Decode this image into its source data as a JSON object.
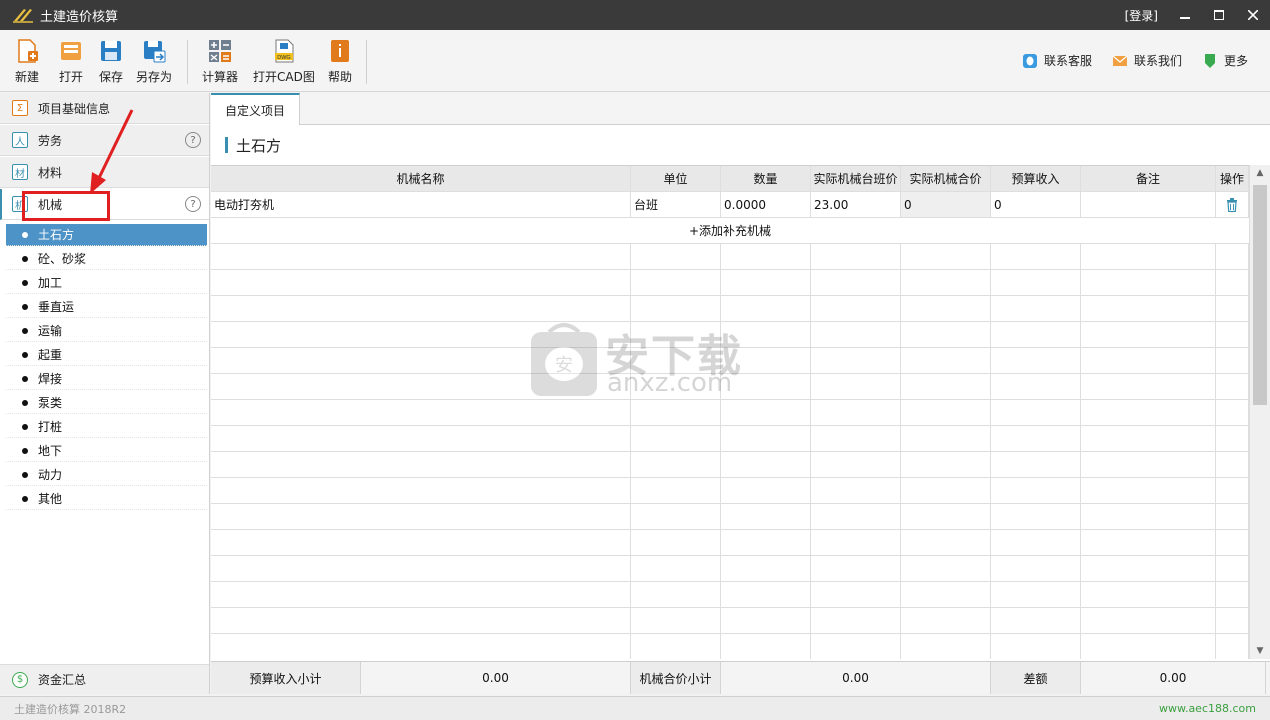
{
  "window": {
    "title": "土建造价核算",
    "login": "[登录]"
  },
  "toolbar": {
    "buttons": [
      {
        "label": "新建",
        "icon": "new-file-icon"
      },
      {
        "label": "打开",
        "icon": "open-folder-icon"
      },
      {
        "label": "保存",
        "icon": "save-icon"
      },
      {
        "label": "另存为",
        "icon": "save-as-icon"
      },
      {
        "label": "计算器",
        "icon": "calculator-icon"
      },
      {
        "label": "打开CAD图",
        "icon": "dwg-file-icon"
      },
      {
        "label": "帮助",
        "icon": "help-book-icon"
      }
    ],
    "right": [
      {
        "label": "联系客服",
        "icon": "qq-icon"
      },
      {
        "label": "联系我们",
        "icon": "mail-icon"
      },
      {
        "label": "更多",
        "icon": "more-icon"
      }
    ]
  },
  "sidebar": {
    "categories": [
      {
        "label": "项目基础信息",
        "glyph": "Σ"
      },
      {
        "label": "劳务",
        "glyph": "人"
      },
      {
        "label": "材料",
        "glyph": "材"
      },
      {
        "label": "机械",
        "glyph": "机"
      }
    ],
    "sub_items": [
      "土石方",
      "砼、砂浆",
      "加工",
      "垂直运",
      "运输",
      "起重",
      "焊接",
      "泵类",
      "打桩",
      "地下",
      "动力",
      "其他"
    ],
    "selected_sub": "土石方",
    "bottom": {
      "label": "资金汇总",
      "glyph": "$"
    },
    "help_glyph": "?"
  },
  "main": {
    "tab": "自定义项目",
    "section_title": "土石方",
    "columns": [
      "机械名称",
      "单位",
      "数量",
      "实际机械台班价",
      "实际机械合价",
      "预算收入",
      "备注",
      "操作"
    ],
    "rows": [
      {
        "name": "电动打夯机",
        "unit": "台班",
        "qty": "0.0000",
        "price": "23.00",
        "total": "0",
        "budget": "0",
        "note": ""
      }
    ],
    "add_row": "+添加补充机械",
    "totals": {
      "budget_label": "预算收入小计",
      "budget_value": "0.00",
      "machine_label": "机械合价小计",
      "machine_value": "0.00",
      "diff_label": "差额",
      "diff_value": "0.00"
    }
  },
  "watermark": {
    "text": "安下载",
    "url": "anxz.com"
  },
  "statusbar": {
    "text": "土建造价核算 2018R2",
    "site": "www.aec188.com"
  },
  "colors": {
    "accent": "#3a8fb0",
    "selected": "#4e93c8",
    "annotation": "#e02020"
  }
}
